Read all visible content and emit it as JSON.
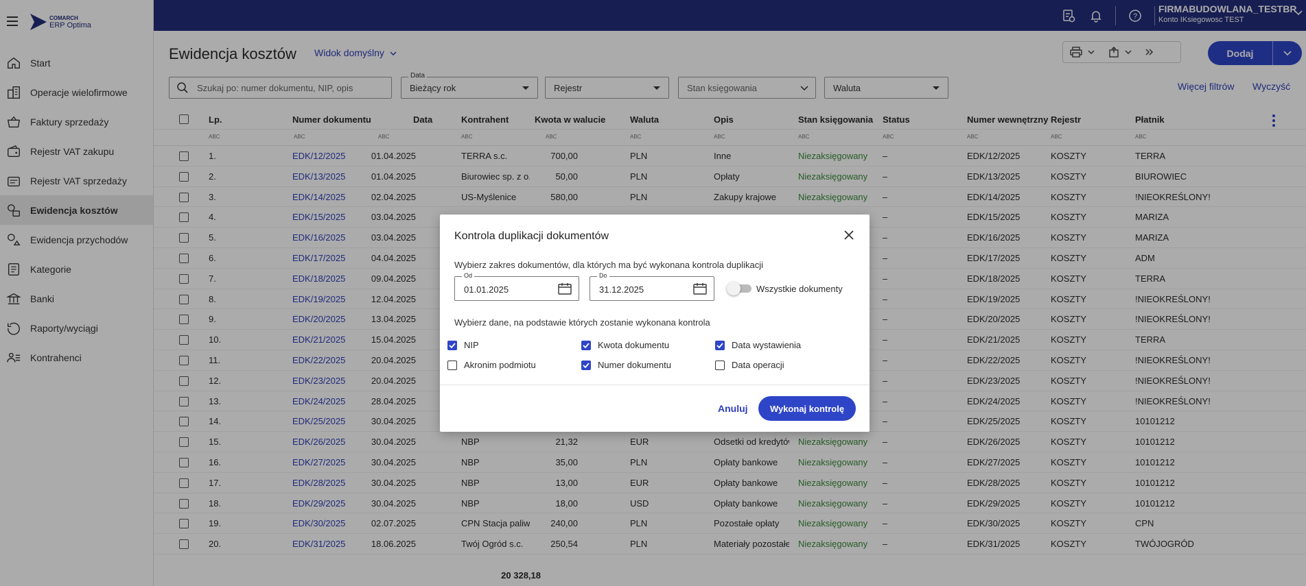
{
  "topbar": {
    "company": "FIRMABUDOWLANA_TESTBR",
    "account": "Konto IKsiegowosc TEST"
  },
  "sidebar": {
    "logo_line1": "COMARCH",
    "logo_line2": "ERP Optima",
    "items": [
      {
        "label": "Start",
        "icon": "home-icon"
      },
      {
        "label": "Operacje wielofirmowe",
        "icon": "buildings-icon"
      },
      {
        "label": "Faktury sprzedaży",
        "icon": "basket-icon"
      },
      {
        "label": "Rejestr VAT zakupu",
        "icon": "wallet-icon"
      },
      {
        "label": "Rejestr VAT sprzedaży",
        "icon": "register-icon"
      },
      {
        "label": "Ewidencja kosztów",
        "icon": "costs-icon",
        "active": true
      },
      {
        "label": "Ewidencja przychodów",
        "icon": "revenue-icon"
      },
      {
        "label": "Kategorie",
        "icon": "category-icon"
      },
      {
        "label": "Banki",
        "icon": "bank-icon"
      },
      {
        "label": "Raporty/wyciągi",
        "icon": "reports-icon"
      },
      {
        "label": "Kontrahenci",
        "icon": "contacts-icon"
      }
    ]
  },
  "main": {
    "title": "Ewidencja kosztów",
    "view": "Widok domyślny",
    "add_label": "Dodaj",
    "search_placeholder": "Szukaj po: numer dokumentu, NIP, opis",
    "filter_data_label": "Data",
    "filter_data_value": "Bieżący rok",
    "filter_rejestr": "Rejestr",
    "filter_stan": "Stan księgowania",
    "filter_waluta": "Waluta",
    "more_filters": "Więcej filtrów",
    "clear": "Wyczyść",
    "columns": {
      "lp": "Lp.",
      "numer": "Numer dokumentu",
      "data": "Data",
      "kontrahent": "Kontrahent",
      "kwota": "Kwota w walucie",
      "waluta": "Waluta",
      "opis": "Opis",
      "stan": "Stan księgowania",
      "status": "Status",
      "numer_wew": "Numer wewnętrzny",
      "rejestr": "Rejestr",
      "platnik": "Płatnik"
    },
    "filter_marker": "ABC",
    "total": "20 328,18"
  },
  "rows": [
    {
      "lp": "1.",
      "numer": "EDK/12/2025",
      "data": "01.04.2025",
      "kontrahent": "TERRA s.c.",
      "kwota": "700,00",
      "waluta": "PLN",
      "opis": "Inne",
      "stan": "Niezaksięgowany",
      "status": "–",
      "wew": "EDK/12/2025",
      "rejestr": "KOSZTY",
      "platnik": "TERRA"
    },
    {
      "lp": "2.",
      "numer": "EDK/13/2025",
      "data": "01.04.2025",
      "kontrahent": "Biurowiec sp. z o.o.",
      "kwota": "50,00",
      "waluta": "PLN",
      "opis": "Opłaty",
      "stan": "Niezaksięgowany",
      "status": "–",
      "wew": "EDK/13/2025",
      "rejestr": "KOSZTY",
      "platnik": "BIUROWIEC"
    },
    {
      "lp": "3.",
      "numer": "EDK/14/2025",
      "data": "02.04.2025",
      "kontrahent": "US-Myślenice",
      "kwota": "580,00",
      "waluta": "PLN",
      "opis": "Zakupy krajowe",
      "stan": "Niezaksięgowany",
      "status": "–",
      "wew": "EDK/14/2025",
      "rejestr": "KOSZTY",
      "platnik": "!NIEOKREŚLONY!"
    },
    {
      "lp": "4.",
      "numer": "EDK/15/2025",
      "data": "03.04.2025",
      "kontrahent": "",
      "kwota": "",
      "waluta": "",
      "opis": "",
      "stan": "",
      "status": "–",
      "wew": "EDK/15/2025",
      "rejestr": "KOSZTY",
      "platnik": "MARIZA"
    },
    {
      "lp": "5.",
      "numer": "EDK/16/2025",
      "data": "03.04.2025",
      "kontrahent": "",
      "kwota": "",
      "waluta": "",
      "opis": "",
      "stan": "",
      "status": "–",
      "wew": "EDK/16/2025",
      "rejestr": "KOSZTY",
      "platnik": "MARIZA"
    },
    {
      "lp": "6.",
      "numer": "EDK/17/2025",
      "data": "04.04.2025",
      "kontrahent": "",
      "kwota": "",
      "waluta": "",
      "opis": "",
      "stan": "",
      "status": "–",
      "wew": "EDK/17/2025",
      "rejestr": "KOSZTY",
      "platnik": "ADM"
    },
    {
      "lp": "7.",
      "numer": "EDK/18/2025",
      "data": "09.04.2025",
      "kontrahent": "",
      "kwota": "",
      "waluta": "",
      "opis": "",
      "stan": "",
      "status": "–",
      "wew": "EDK/18/2025",
      "rejestr": "KOSZTY",
      "platnik": "TERRA"
    },
    {
      "lp": "8.",
      "numer": "EDK/19/2025",
      "data": "12.04.2025",
      "kontrahent": "",
      "kwota": "",
      "waluta": "",
      "opis": "",
      "stan": "",
      "status": "–",
      "wew": "EDK/19/2025",
      "rejestr": "KOSZTY",
      "platnik": "!NIEOKREŚLONY!"
    },
    {
      "lp": "9.",
      "numer": "EDK/20/2025",
      "data": "13.04.2025",
      "kontrahent": "",
      "kwota": "",
      "waluta": "",
      "opis": "",
      "stan": "",
      "status": "–",
      "wew": "EDK/20/2025",
      "rejestr": "KOSZTY",
      "platnik": "!NIEOKREŚLONY!"
    },
    {
      "lp": "10.",
      "numer": "EDK/21/2025",
      "data": "15.04.2025",
      "kontrahent": "",
      "kwota": "",
      "waluta": "",
      "opis": "",
      "stan": "",
      "status": "–",
      "wew": "EDK/21/2025",
      "rejestr": "KOSZTY",
      "platnik": "TERRA"
    },
    {
      "lp": "11.",
      "numer": "EDK/22/2025",
      "data": "20.04.2025",
      "kontrahent": "",
      "kwota": "",
      "waluta": "",
      "opis": "",
      "stan": "",
      "status": "–",
      "wew": "EDK/22/2025",
      "rejestr": "KOSZTY",
      "platnik": "!NIEOKREŚLONY!"
    },
    {
      "lp": "12.",
      "numer": "EDK/23/2025",
      "data": "20.04.2025",
      "kontrahent": "",
      "kwota": "",
      "waluta": "",
      "opis": "",
      "stan": "",
      "status": "–",
      "wew": "EDK/23/2025",
      "rejestr": "KOSZTY",
      "platnik": "!NIEOKREŚLONY!"
    },
    {
      "lp": "13.",
      "numer": "EDK/24/2025",
      "data": "28.04.2025",
      "kontrahent": "",
      "kwota": "",
      "waluta": "",
      "opis": "",
      "stan": "",
      "status": "–",
      "wew": "EDK/24/2025",
      "rejestr": "KOSZTY",
      "platnik": "!NIEOKREŚLONY!"
    },
    {
      "lp": "14.",
      "numer": "EDK/25/2025",
      "data": "30.04.2025",
      "kontrahent": "",
      "kwota": "",
      "waluta": "",
      "opis": "",
      "stan": "",
      "status": "–",
      "wew": "EDK/25/2025",
      "rejestr": "KOSZTY",
      "platnik": "10101212"
    },
    {
      "lp": "15.",
      "numer": "EDK/26/2025",
      "data": "30.04.2025",
      "kontrahent": "NBP",
      "kwota": "21,32",
      "waluta": "EUR",
      "opis": "Odsetki od kredytów",
      "stan": "Niezaksięgowany",
      "status": "–",
      "wew": "EDK/26/2025",
      "rejestr": "KOSZTY",
      "platnik": "10101212"
    },
    {
      "lp": "16.",
      "numer": "EDK/27/2025",
      "data": "30.04.2025",
      "kontrahent": "NBP",
      "kwota": "35,00",
      "waluta": "PLN",
      "opis": "Opłaty bankowe",
      "stan": "Niezaksięgowany",
      "status": "–",
      "wew": "EDK/27/2025",
      "rejestr": "KOSZTY",
      "platnik": "10101212"
    },
    {
      "lp": "17.",
      "numer": "EDK/28/2025",
      "data": "30.04.2025",
      "kontrahent": "NBP",
      "kwota": "13,00",
      "waluta": "EUR",
      "opis": "Opłaty bankowe",
      "stan": "Niezaksięgowany",
      "status": "–",
      "wew": "EDK/28/2025",
      "rejestr": "KOSZTY",
      "platnik": "10101212"
    },
    {
      "lp": "18.",
      "numer": "EDK/29/2025",
      "data": "30.04.2025",
      "kontrahent": "NBP",
      "kwota": "18,00",
      "waluta": "USD",
      "opis": "Opłaty bankowe",
      "stan": "Niezaksięgowany",
      "status": "–",
      "wew": "EDK/29/2025",
      "rejestr": "KOSZTY",
      "platnik": "10101212"
    },
    {
      "lp": "19.",
      "numer": "EDK/30/2025",
      "data": "02.07.2025",
      "kontrahent": "CPN Stacja paliw",
      "kwota": "240,00",
      "waluta": "PLN",
      "opis": "Pozostałe opłaty",
      "stan": "Niezaksięgowany",
      "status": "–",
      "wew": "EDK/30/2025",
      "rejestr": "KOSZTY",
      "platnik": "CPN"
    },
    {
      "lp": "20.",
      "numer": "EDK/31/2025",
      "data": "18.06.2025",
      "kontrahent": "Twój Ogród s.c.",
      "kwota": "250,54",
      "waluta": "PLN",
      "opis": "Materiały pozostałe",
      "stan": "Niezaksięgowany",
      "status": "–",
      "wew": "EDK/31/2025",
      "rejestr": "KOSZTY",
      "platnik": "TWÓJOGRÓD"
    }
  ],
  "modal": {
    "title": "Kontrola duplikacji dokumentów",
    "range_label": "Wybierz zakres dokumentów, dla których ma być wykonana kontrola duplikacji",
    "from_label": "Od",
    "from_value": "01.01.2025",
    "to_label": "Do",
    "to_value": "31.12.2025",
    "all_docs_label": "Wszystkie dokumenty",
    "all_docs_on": false,
    "criteria_label": "Wybierz dane, na podstawie których zostanie wykonana kontrola",
    "criteria": [
      {
        "label": "NIP",
        "checked": true
      },
      {
        "label": "Kwota dokumentu",
        "checked": true
      },
      {
        "label": "Data wystawienia",
        "checked": true
      },
      {
        "label": "Akronim podmiotu",
        "checked": false
      },
      {
        "label": "Numer dokumentu",
        "checked": true
      },
      {
        "label": "Data operacji",
        "checked": false
      }
    ],
    "cancel": "Anuluj",
    "run": "Wykonaj kontrolę"
  },
  "colors": {
    "topbar": "#232d7b",
    "accent": "#2f45c7",
    "status_green": "#3b8a3b"
  }
}
